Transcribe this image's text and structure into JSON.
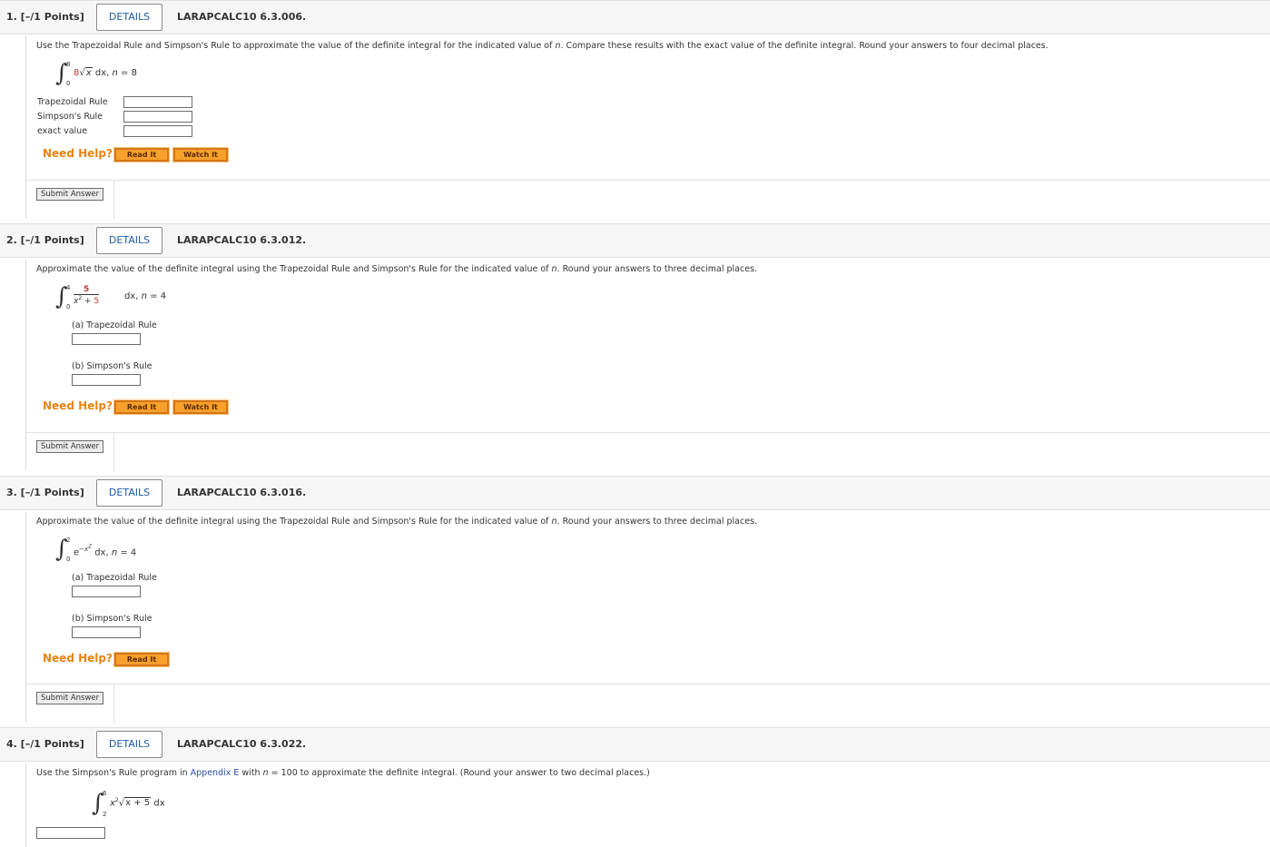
{
  "questions": [
    {
      "points": "1. [–/1 Points]",
      "details": "DETAILS",
      "code": "LARAPCALC10 6.3.006.",
      "prompt_pre": "Use the Trapezoidal Rule and Simpson's Rule to approximate the value of the definite integral for the indicated value of ",
      "prompt_var": "n",
      "prompt_post": ". Compare these results with the exact value of the definite integral. Round your answers to four decimal places.",
      "integral": {
        "lower": "0",
        "upper": "8",
        "coef": "8",
        "radicand": "x",
        "tail": "dx, ",
        "n_var": "n",
        "n_rest": " = 8"
      },
      "labels": [
        "Trapezoidal Rule",
        "Simpson's Rule",
        "exact value"
      ],
      "need_help": "Need Help?",
      "read_it": "Read It",
      "watch_it": "Watch It",
      "submit": "Submit Answer"
    },
    {
      "points": "2. [–/1 Points]",
      "details": "DETAILS",
      "code": "LARAPCALC10 6.3.012.",
      "prompt_pre": "Approximate the value of the definite integral using the Trapezoidal Rule and Simpson's Rule for the indicated value of ",
      "prompt_var": "n",
      "prompt_post": ". Round your answers to three decimal places.",
      "integral": {
        "lower": "0",
        "upper": "4",
        "numerator": "5",
        "den_base": "x",
        "den_exp": "2",
        "den_plus": " + ",
        "den_const": "5",
        "tail": "dx, ",
        "n_var": "n",
        "n_rest": " = 4"
      },
      "part_a": "(a) Trapezoidal Rule",
      "part_b": "(b) Simpson's Rule",
      "need_help": "Need Help?",
      "read_it": "Read It",
      "watch_it": "Watch It",
      "submit": "Submit Answer"
    },
    {
      "points": "3. [–/1 Points]",
      "details": "DETAILS",
      "code": "LARAPCALC10 6.3.016.",
      "prompt_pre": "Approximate the value of the definite integral using the Trapezoidal Rule and Simpson's Rule for the indicated value of ",
      "prompt_var": "n",
      "prompt_post": ". Round your answers to three decimal places.",
      "integral": {
        "lower": "0",
        "upper": "2",
        "base": "e",
        "exp": "−x",
        "exp_pow": "2",
        "tail": "dx, ",
        "n_var": "n",
        "n_rest": " = 4"
      },
      "part_a": "(a) Trapezoidal Rule",
      "part_b": "(b) Simpson's Rule",
      "need_help": "Need Help?",
      "read_it": "Read It",
      "submit": "Submit Answer"
    },
    {
      "points": "4. [–/1 Points]",
      "details": "DETAILS",
      "code": "LARAPCALC10 6.3.022.",
      "prompt_pre": "Use the Simpson's Rule program in ",
      "prompt_link": "Appendix E",
      "prompt_mid": " with ",
      "prompt_var": "n",
      "prompt_post": " = 100 to approximate the definite integral. (Round your answer to two decimal places.)",
      "integral": {
        "lower": "2",
        "upper": "6",
        "base": "x",
        "pow": "2",
        "radicand": "x + 5",
        "tail": "dx"
      }
    }
  ]
}
